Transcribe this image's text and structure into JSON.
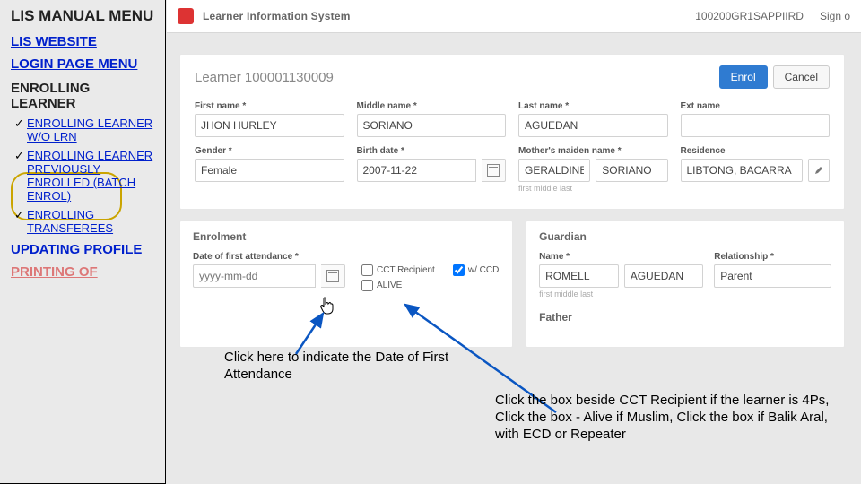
{
  "manual": {
    "title": "LIS MANUAL MENU",
    "links": {
      "website": "LIS WEBSITE",
      "login": "LOGIN PAGE MENU",
      "enrolling_header": "ENROLLING LEARNER",
      "item_wo_lrn": "ENROLLING LEARNER W/O LRN",
      "item_batch": "ENROLLING LEARNER PREVIOUSLY ENROLLED (BATCH ENROL)",
      "item_transferees": "ENROLLING TRANSFEREES",
      "updating": "UPDATING PROFILE",
      "printing": "PRINTING OF"
    }
  },
  "appbar": {
    "brand": "Learner Information System",
    "user": "100200GR1SAPPIIRD",
    "signout": "Sign o"
  },
  "learner": {
    "title_prefix": "Learner ",
    "lrn": "100001130009"
  },
  "buttons": {
    "enrol": "Enrol",
    "cancel": "Cancel"
  },
  "labels": {
    "first": "First name",
    "middle": "Middle name",
    "last": "Last name",
    "ext": "Ext name",
    "gender": "Gender",
    "birth": "Birth date",
    "birth_ph": "yyyy-mm-dd",
    "maiden": "Mother's maiden name",
    "residence": "Residence",
    "enrolment": "Enrolment",
    "dofa": "Date of first attendance",
    "guardian": "Guardian",
    "gname": "Name",
    "grel": "Relationship",
    "father": "Father",
    "help_fml": "first middle last",
    "help_fml2": "first middle last"
  },
  "values": {
    "first": "JHON HURLEY",
    "middle": "SORIANO",
    "last": "AGUEDAN",
    "ext": "",
    "gender": "Female",
    "birth": "2007-11-22",
    "maiden_first": "GERALDINE",
    "maiden_last": "SORIANO",
    "residence": "LIBTONG, BACARRA",
    "guardian_first": "ROMELL",
    "guardian_last": "AGUEDAN",
    "relationship": "Parent"
  },
  "checks": {
    "cct": "CCT Recipient",
    "ccd": "w/ CCD",
    "alive": "ALIVE"
  },
  "callouts": {
    "date": "Click here to indicate the Date of First Attendance",
    "boxes": "Click the box beside CCT Recipient if the learner is 4Ps, Click the box - Alive if Muslim, Click the box if Balik Aral, with ECD or Repeater"
  }
}
